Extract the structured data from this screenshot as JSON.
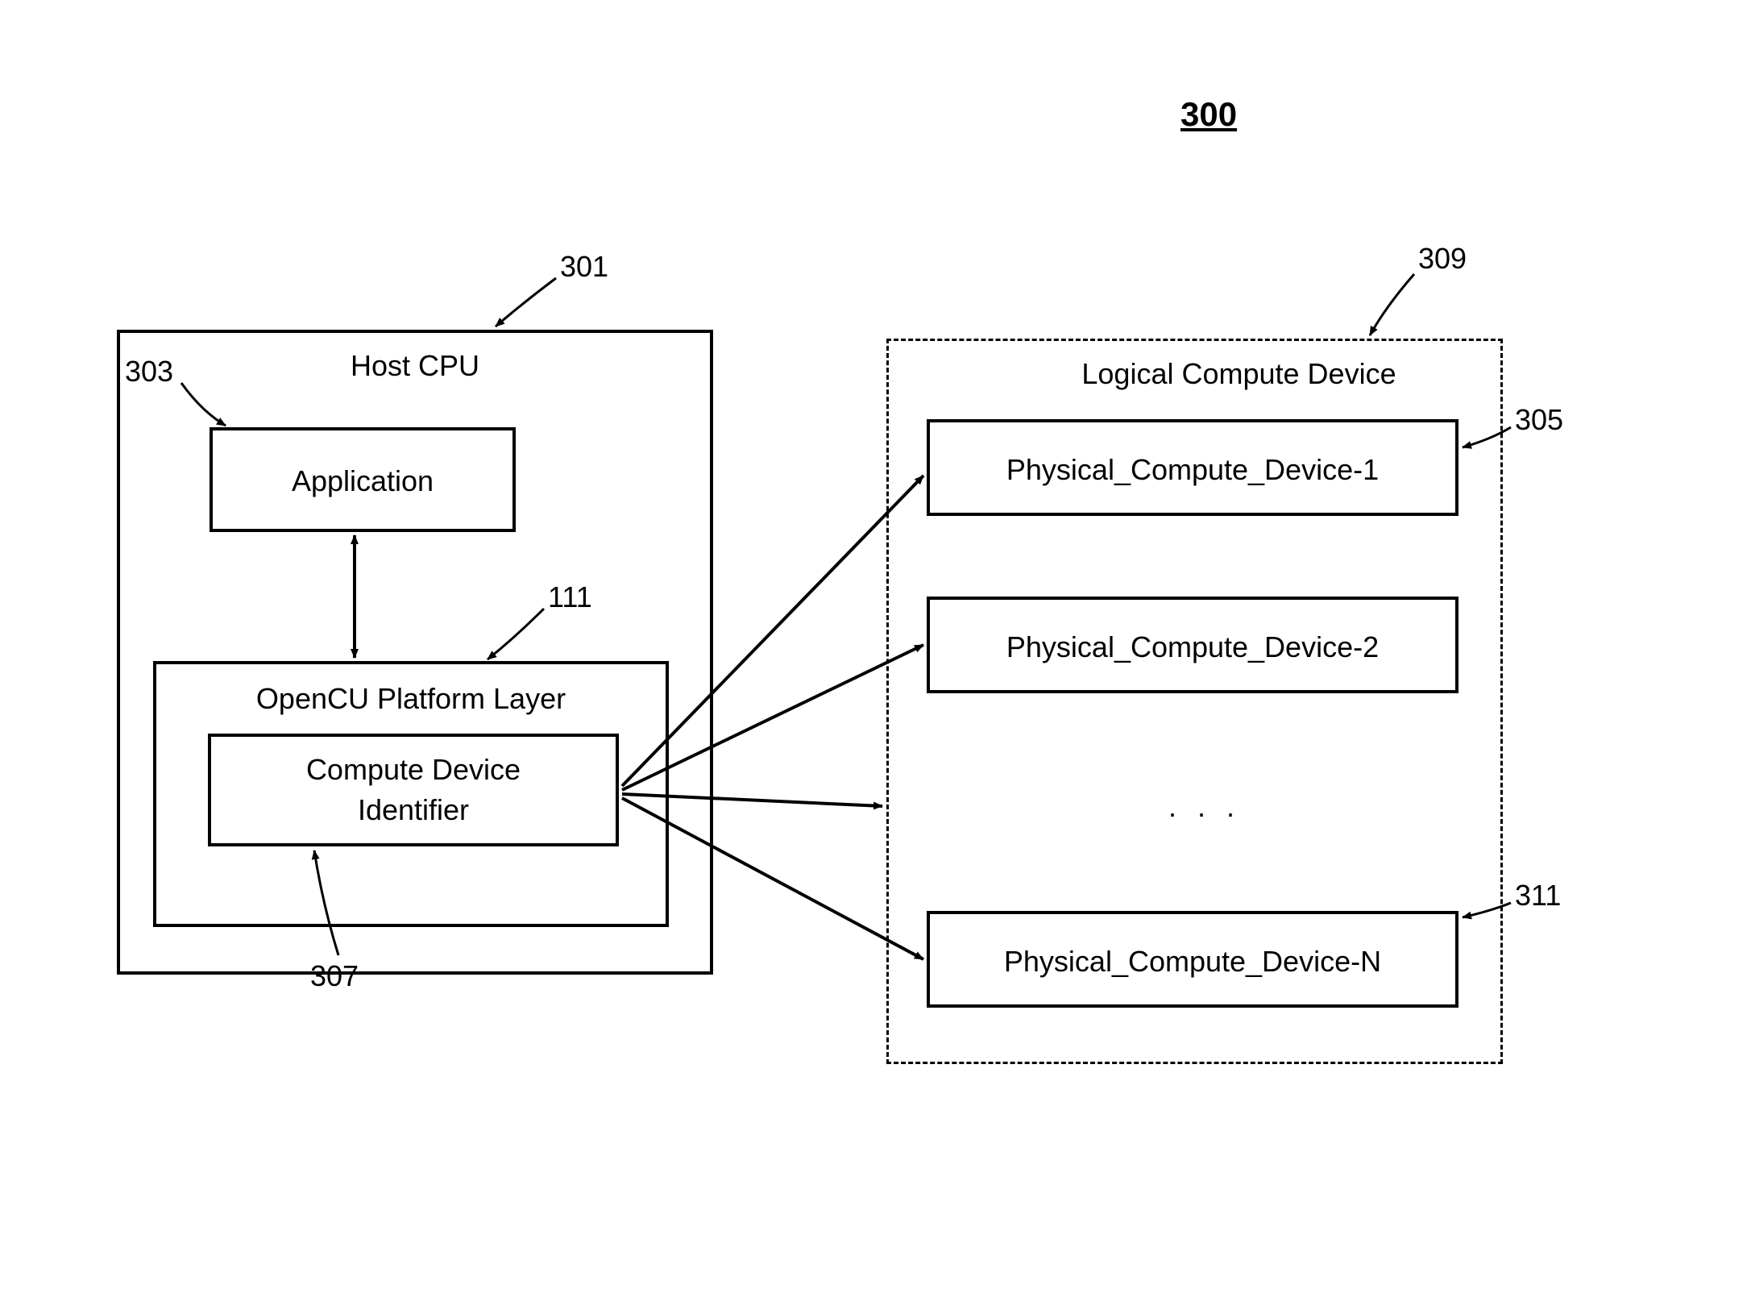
{
  "figure_number": "300",
  "host_cpu": {
    "title": "Host CPU",
    "ref": "301",
    "application": {
      "label": "Application",
      "ref": "303"
    },
    "platform_layer": {
      "label": "OpenCU Platform Layer",
      "ref": "111",
      "compute_device_identifier": {
        "label": "Compute Device\nIdentifier",
        "line1": "Compute Device",
        "line2": "Identifier",
        "ref": "307"
      }
    }
  },
  "logical_compute_device": {
    "title": "Logical Compute Device",
    "ref": "309",
    "devices": [
      {
        "label": "Physical_Compute_Device-1",
        "ref": "305"
      },
      {
        "label": "Physical_Compute_Device-2",
        "ref": ""
      },
      {
        "label": "Physical_Compute_Device-N",
        "ref": "311"
      }
    ],
    "ellipsis": ". . ."
  }
}
